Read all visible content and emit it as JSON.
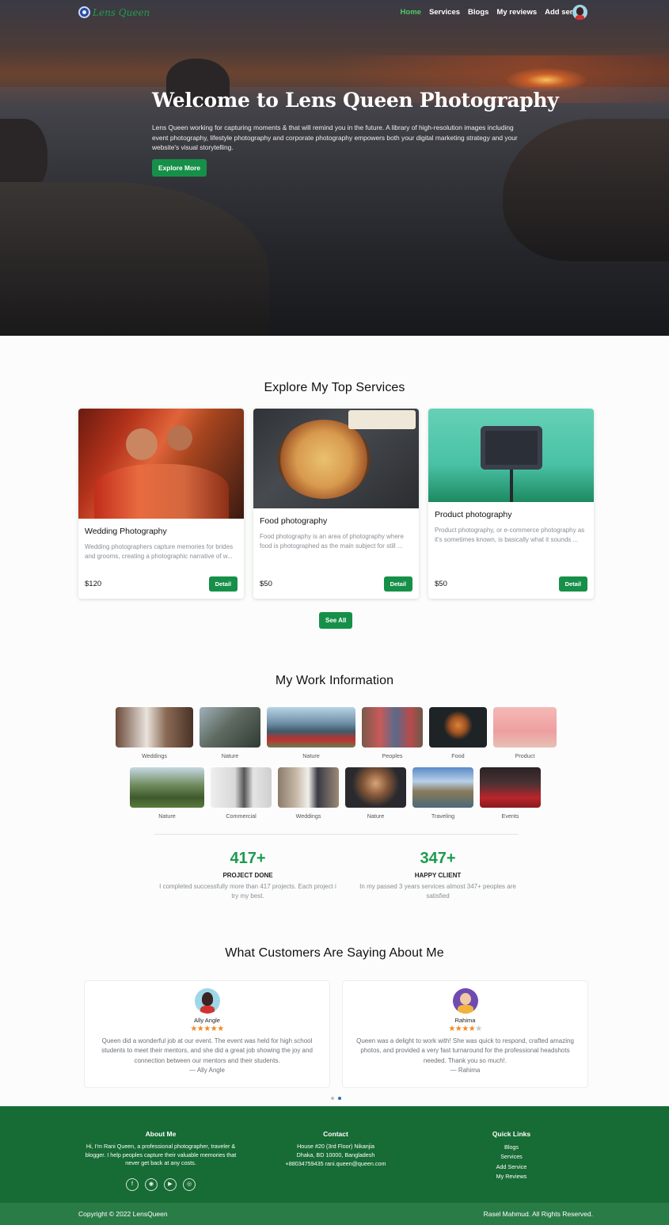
{
  "nav": {
    "brand": "Lens Queen",
    "items": [
      "Home",
      "Services",
      "Blogs",
      "My reviews",
      "Add service"
    ],
    "active_item": "Home",
    "accent_color": "#4ecb66"
  },
  "hero": {
    "title": "Welcome to Lens Queen Photography",
    "text": "Lens Queen working for capturing moments & that will remind you in the future. A library of high-resolution images including event photography, lifestyle photography and corporate photography empowers both your digital marketing strategy and your website's visual storytelling.",
    "button": "Explore More"
  },
  "services": {
    "title": "Explore My Top Services",
    "cards": [
      {
        "title": "Wedding Photography",
        "description": "Wedding photographers capture memories for brides and grooms, creating a photographic narrative of w...",
        "price": "$120",
        "button": "Detail"
      },
      {
        "title": "Food photography",
        "description": "Food photography is an area of photography where food is photographed as the main subject for still ...",
        "price": "$50",
        "button": "Detail"
      },
      {
        "title": "Product photography",
        "description": "Product photography, or e-commerce photography as it's sometimes known, is basically what it sounds ...",
        "price": "$50",
        "button": "Detail"
      }
    ],
    "see_all": "See All"
  },
  "work": {
    "title": "My Work Information",
    "row1": [
      "Weddings",
      "Nature",
      "Nature",
      "Peoples",
      "Food",
      "Product"
    ],
    "row2": [
      "Nature",
      "Commercial",
      "Weddings",
      "Nature",
      "Traveling",
      "Events"
    ],
    "stats": [
      {
        "number": "417+",
        "label": "PROJECT DONE",
        "description": "I completed successfully more than 417 projects. Each project i try my best."
      },
      {
        "number": "347+",
        "label": "HAPPY CLIENT",
        "description": "In my passed 3 years services almost 347+ peoples are satisfied"
      }
    ],
    "accent_color": "#1e9a50"
  },
  "reviews": {
    "title": "What Customers Are Saying About Me",
    "items": [
      {
        "name": "Ally Angle",
        "rating": 5,
        "text": "Queen did a wonderful job at our event. The event was held for high school students to meet their mentors, and she did a great job showing the joy and connection between our mentors and their students.",
        "signature": "— Ally Angle"
      },
      {
        "name": "Rahima",
        "rating": 4,
        "text": "Queen was a delight to work with! She was quick to respond, crafted amazing photos, and provided a very fast turnaround for the professional headshots needed. Thank you so much!.",
        "signature": "— Rahima"
      }
    ],
    "star_color": "#f08a24"
  },
  "footer": {
    "about": {
      "title": "About Me",
      "text": "Hi, I'm Rani Queen, a professional photographer, traveler & blogger. I help peoples capture their valuable memories that never get back at any costs."
    },
    "social_icons": [
      "facebook-icon",
      "github-icon",
      "youtube-icon",
      "instagram-icon"
    ],
    "contact": {
      "title": "Contact",
      "line1": "House #20 (3rd Floor) Nikanjia",
      "line2": "Dhaka, BD 10000, Bangladesh",
      "line3": "+88034759435 rani.queen@queen.com"
    },
    "quick_links": {
      "title": "Quick Links",
      "items": [
        "Blogs",
        "Services",
        "Add Service",
        "My Reviews"
      ]
    },
    "copyright": "Copyright © 2022 LensQueen",
    "rights": "Rasel Mahmud. All Rights Reserved.",
    "bg_color": "#176b34"
  }
}
